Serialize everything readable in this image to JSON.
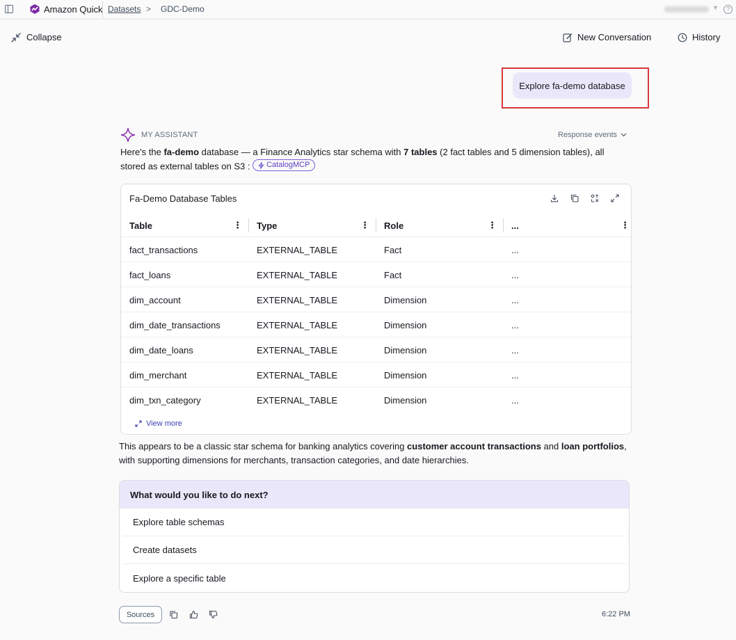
{
  "topbar": {
    "brand": "Amazon Quick",
    "breadcrumb_link": "Datasets",
    "breadcrumb_current": "GDC-Demo"
  },
  "header": {
    "collapse_label": "Collapse",
    "new_conversation_label": "New Conversation",
    "history_label": "History"
  },
  "user_message": "Explore fa-demo database",
  "assistant": {
    "label": "MY ASSISTANT",
    "response_events": "Response events",
    "intro_1": "Here's the ",
    "intro_db": "fa-demo",
    "intro_2": " database — a Finance Analytics star schema with ",
    "intro_count": "7 tables",
    "intro_3": " (2 fact tables and 5 dimension tables), all stored as external tables on S3 : ",
    "badge": "CatalogMCP"
  },
  "table_card": {
    "title": "Fa-Demo Database Tables",
    "columns": [
      "Table",
      "Type",
      "Role",
      "..."
    ],
    "rows": [
      [
        "fact_transactions",
        "EXTERNAL_TABLE",
        "Fact",
        "..."
      ],
      [
        "fact_loans",
        "EXTERNAL_TABLE",
        "Fact",
        "..."
      ],
      [
        "dim_account",
        "EXTERNAL_TABLE",
        "Dimension",
        "..."
      ],
      [
        "dim_date_transactions",
        "EXTERNAL_TABLE",
        "Dimension",
        "..."
      ],
      [
        "dim_date_loans",
        "EXTERNAL_TABLE",
        "Dimension",
        "..."
      ],
      [
        "dim_merchant",
        "EXTERNAL_TABLE",
        "Dimension",
        "..."
      ],
      [
        "dim_txn_category",
        "EXTERNAL_TABLE",
        "Dimension",
        "..."
      ]
    ],
    "view_more": "View more"
  },
  "summary": {
    "s1": "This appears to be a classic star schema for banking analytics covering ",
    "b1": "customer account transactions",
    "s2": " and ",
    "b2": "loan portfolios",
    "s3": ", with supporting dimensions for merchants, transaction categories, and date hierarchies."
  },
  "next_steps": {
    "heading": "What would you like to do next?",
    "items": [
      "Explore table schemas",
      "Create datasets",
      "Explore a specific table"
    ]
  },
  "footer": {
    "sources_label": "Sources",
    "timestamp": "6:22 PM"
  },
  "colors": {
    "accent": "#5b3fc4",
    "bubble": "#ebe7fa",
    "highlight": "#d9383a"
  }
}
